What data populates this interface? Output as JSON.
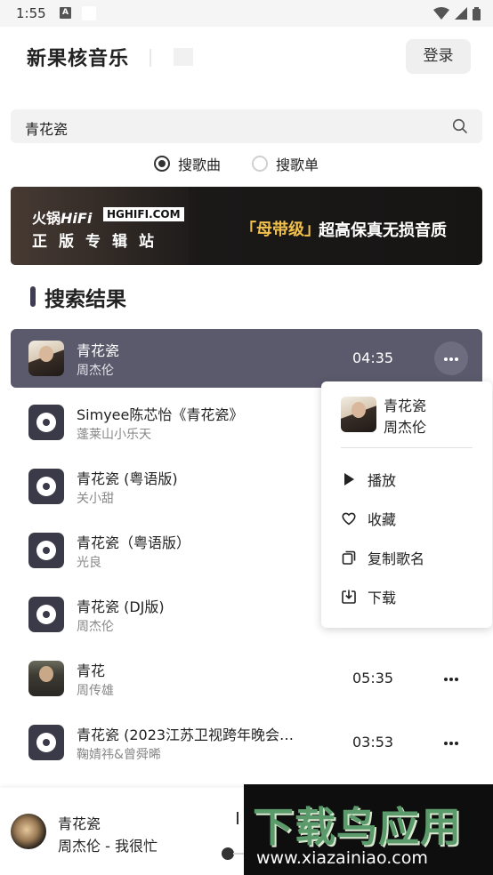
{
  "status_bar": {
    "time": "1:55",
    "badge": "A"
  },
  "header": {
    "app_title": "新果核音乐",
    "login_label": "登录"
  },
  "search": {
    "value": "青花瓷"
  },
  "search_type": {
    "songs_label": "搜歌曲",
    "playlists_label": "搜歌单",
    "selected": "搜歌曲"
  },
  "banner": {
    "brand": "火锅",
    "brand_italic": "HiFi",
    "site": "HGHIFI.COM",
    "subtitle": "正版专辑站",
    "tag": "「母带级」",
    "tagline": "超高保真无损音质"
  },
  "results": {
    "title": "搜索结果",
    "songs": [
      {
        "name": "青花瓷",
        "artist": "周杰伦",
        "duration": "04:35",
        "active": true,
        "art": "photo"
      },
      {
        "name": "Simyee陈芯怡《青花瓷》",
        "artist": "蓬莱山小乐天",
        "duration": "",
        "art": "disc"
      },
      {
        "name": "青花瓷 (粤语版)",
        "artist": "关小甜",
        "duration": "",
        "art": "disc"
      },
      {
        "name": "青花瓷（粤语版）",
        "artist": "光良",
        "duration": "",
        "art": "disc"
      },
      {
        "name": "青花瓷 (DJ版)",
        "artist": "周杰伦",
        "duration": "",
        "art": "disc"
      },
      {
        "name": "青花",
        "artist": "周传雄",
        "duration": "05:35",
        "art": "photo"
      },
      {
        "name": "青花瓷 (2023江苏卫视跨年晚会…",
        "artist": "鞠婧祎&曾舜晞",
        "duration": "03:53",
        "art": "disc"
      }
    ]
  },
  "context_menu": {
    "song": "青花瓷",
    "artist": "周杰伦",
    "items": [
      {
        "label": "播放",
        "icon": "play-icon"
      },
      {
        "label": "收藏",
        "icon": "heart-icon"
      },
      {
        "label": "复制歌名",
        "icon": "copy-icon"
      },
      {
        "label": "下载",
        "icon": "download-icon"
      }
    ]
  },
  "player": {
    "title": "青花瓷",
    "subtitle": "周杰伦 - 我很忙"
  },
  "watermark": {
    "text": "下载鸟应用",
    "url": "www.xiazainiao.com"
  }
}
